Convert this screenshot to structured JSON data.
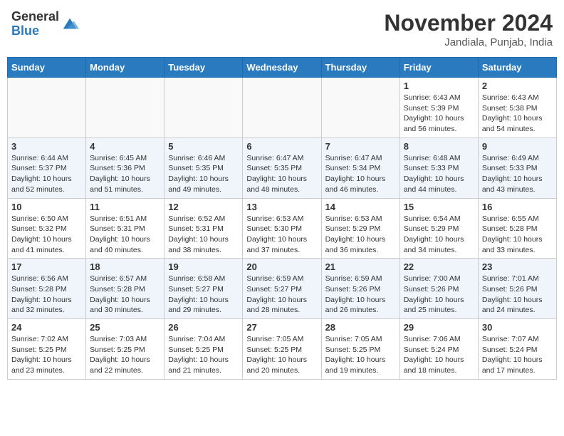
{
  "header": {
    "logo_line1": "General",
    "logo_line2": "Blue",
    "month": "November 2024",
    "location": "Jandiala, Punjab, India"
  },
  "weekdays": [
    "Sunday",
    "Monday",
    "Tuesday",
    "Wednesday",
    "Thursday",
    "Friday",
    "Saturday"
  ],
  "weeks": [
    [
      {
        "day": "",
        "info": ""
      },
      {
        "day": "",
        "info": ""
      },
      {
        "day": "",
        "info": ""
      },
      {
        "day": "",
        "info": ""
      },
      {
        "day": "",
        "info": ""
      },
      {
        "day": "1",
        "info": "Sunrise: 6:43 AM\nSunset: 5:39 PM\nDaylight: 10 hours and 56 minutes."
      },
      {
        "day": "2",
        "info": "Sunrise: 6:43 AM\nSunset: 5:38 PM\nDaylight: 10 hours and 54 minutes."
      }
    ],
    [
      {
        "day": "3",
        "info": "Sunrise: 6:44 AM\nSunset: 5:37 PM\nDaylight: 10 hours and 52 minutes."
      },
      {
        "day": "4",
        "info": "Sunrise: 6:45 AM\nSunset: 5:36 PM\nDaylight: 10 hours and 51 minutes."
      },
      {
        "day": "5",
        "info": "Sunrise: 6:46 AM\nSunset: 5:35 PM\nDaylight: 10 hours and 49 minutes."
      },
      {
        "day": "6",
        "info": "Sunrise: 6:47 AM\nSunset: 5:35 PM\nDaylight: 10 hours and 48 minutes."
      },
      {
        "day": "7",
        "info": "Sunrise: 6:47 AM\nSunset: 5:34 PM\nDaylight: 10 hours and 46 minutes."
      },
      {
        "day": "8",
        "info": "Sunrise: 6:48 AM\nSunset: 5:33 PM\nDaylight: 10 hours and 44 minutes."
      },
      {
        "day": "9",
        "info": "Sunrise: 6:49 AM\nSunset: 5:33 PM\nDaylight: 10 hours and 43 minutes."
      }
    ],
    [
      {
        "day": "10",
        "info": "Sunrise: 6:50 AM\nSunset: 5:32 PM\nDaylight: 10 hours and 41 minutes."
      },
      {
        "day": "11",
        "info": "Sunrise: 6:51 AM\nSunset: 5:31 PM\nDaylight: 10 hours and 40 minutes."
      },
      {
        "day": "12",
        "info": "Sunrise: 6:52 AM\nSunset: 5:31 PM\nDaylight: 10 hours and 38 minutes."
      },
      {
        "day": "13",
        "info": "Sunrise: 6:53 AM\nSunset: 5:30 PM\nDaylight: 10 hours and 37 minutes."
      },
      {
        "day": "14",
        "info": "Sunrise: 6:53 AM\nSunset: 5:29 PM\nDaylight: 10 hours and 36 minutes."
      },
      {
        "day": "15",
        "info": "Sunrise: 6:54 AM\nSunset: 5:29 PM\nDaylight: 10 hours and 34 minutes."
      },
      {
        "day": "16",
        "info": "Sunrise: 6:55 AM\nSunset: 5:28 PM\nDaylight: 10 hours and 33 minutes."
      }
    ],
    [
      {
        "day": "17",
        "info": "Sunrise: 6:56 AM\nSunset: 5:28 PM\nDaylight: 10 hours and 32 minutes."
      },
      {
        "day": "18",
        "info": "Sunrise: 6:57 AM\nSunset: 5:28 PM\nDaylight: 10 hours and 30 minutes."
      },
      {
        "day": "19",
        "info": "Sunrise: 6:58 AM\nSunset: 5:27 PM\nDaylight: 10 hours and 29 minutes."
      },
      {
        "day": "20",
        "info": "Sunrise: 6:59 AM\nSunset: 5:27 PM\nDaylight: 10 hours and 28 minutes."
      },
      {
        "day": "21",
        "info": "Sunrise: 6:59 AM\nSunset: 5:26 PM\nDaylight: 10 hours and 26 minutes."
      },
      {
        "day": "22",
        "info": "Sunrise: 7:00 AM\nSunset: 5:26 PM\nDaylight: 10 hours and 25 minutes."
      },
      {
        "day": "23",
        "info": "Sunrise: 7:01 AM\nSunset: 5:26 PM\nDaylight: 10 hours and 24 minutes."
      }
    ],
    [
      {
        "day": "24",
        "info": "Sunrise: 7:02 AM\nSunset: 5:25 PM\nDaylight: 10 hours and 23 minutes."
      },
      {
        "day": "25",
        "info": "Sunrise: 7:03 AM\nSunset: 5:25 PM\nDaylight: 10 hours and 22 minutes."
      },
      {
        "day": "26",
        "info": "Sunrise: 7:04 AM\nSunset: 5:25 PM\nDaylight: 10 hours and 21 minutes."
      },
      {
        "day": "27",
        "info": "Sunrise: 7:05 AM\nSunset: 5:25 PM\nDaylight: 10 hours and 20 minutes."
      },
      {
        "day": "28",
        "info": "Sunrise: 7:05 AM\nSunset: 5:25 PM\nDaylight: 10 hours and 19 minutes."
      },
      {
        "day": "29",
        "info": "Sunrise: 7:06 AM\nSunset: 5:24 PM\nDaylight: 10 hours and 18 minutes."
      },
      {
        "day": "30",
        "info": "Sunrise: 7:07 AM\nSunset: 5:24 PM\nDaylight: 10 hours and 17 minutes."
      }
    ]
  ]
}
